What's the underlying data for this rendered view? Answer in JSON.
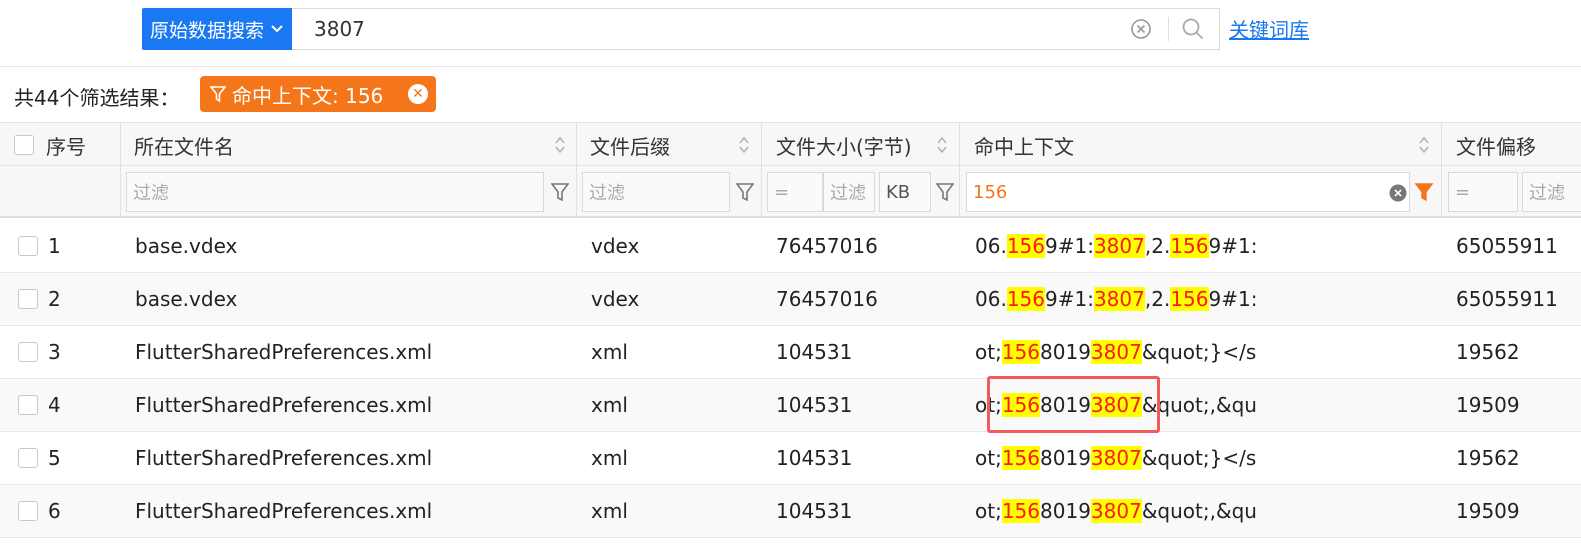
{
  "search": {
    "type_label": "原始数据搜索",
    "query": "3807",
    "keyword_link": "关键词库"
  },
  "summary": {
    "count_text": "共44个筛选结果：",
    "filter_tag": "命中上下文: 156"
  },
  "table": {
    "headers": {
      "index": "序号",
      "filename": "所在文件名",
      "suffix": "文件后缀",
      "size": "文件大小(字节)",
      "context": "命中上下文",
      "offset": "文件偏移"
    },
    "filters": {
      "filename_placeholder": "过滤",
      "suffix_placeholder": "过滤",
      "size_op": "=",
      "size_placeholder": "过滤",
      "size_unit": "KB",
      "context_value": "156",
      "offset_op": "=",
      "offset_placeholder": "过滤"
    },
    "rows": [
      {
        "index": "1",
        "filename": "base.vdex",
        "suffix": "vdex",
        "size": "76457016",
        "context": [
          "06.",
          "156",
          "9#1:",
          "3807",
          ",2.",
          "156",
          "9#1:"
        ],
        "offset": "65055911"
      },
      {
        "index": "2",
        "filename": "base.vdex",
        "suffix": "vdex",
        "size": "76457016",
        "context": [
          "06.",
          "156",
          "9#1:",
          "3807",
          ",2.",
          "156",
          "9#1:"
        ],
        "offset": "65055911"
      },
      {
        "index": "3",
        "filename": "FlutterSharedPreferences.xml",
        "suffix": "xml",
        "size": "104531",
        "context": [
          "ot;",
          "156",
          "8019",
          "3807",
          "&quot;}</s"
        ],
        "offset": "19562"
      },
      {
        "index": "4",
        "filename": "FlutterSharedPreferences.xml",
        "suffix": "xml",
        "size": "104531",
        "context": [
          "ot;",
          "156",
          "8019",
          "3807",
          "&quot;,&qu"
        ],
        "offset": "19509"
      },
      {
        "index": "5",
        "filename": "FlutterSharedPreferences.xml",
        "suffix": "xml",
        "size": "104531",
        "context": [
          "ot;",
          "156",
          "8019",
          "3807",
          "&quot;}</s"
        ],
        "offset": "19562"
      },
      {
        "index": "6",
        "filename": "FlutterSharedPreferences.xml",
        "suffix": "xml",
        "size": "104531",
        "context": [
          "ot;",
          "156",
          "8019",
          "3807",
          "&quot;,&qu"
        ],
        "offset": "19509"
      }
    ]
  },
  "colors": {
    "primary": "#1a79f2",
    "tag": "#f5761a",
    "highlight_bg": "#ffff00",
    "highlight_text": "#ff1a1a",
    "annotation_box": "#f25a5a"
  },
  "icons": [
    "chevron-down-icon",
    "clear-icon",
    "search-icon",
    "filter-icon",
    "close-icon",
    "sort-icon"
  ]
}
